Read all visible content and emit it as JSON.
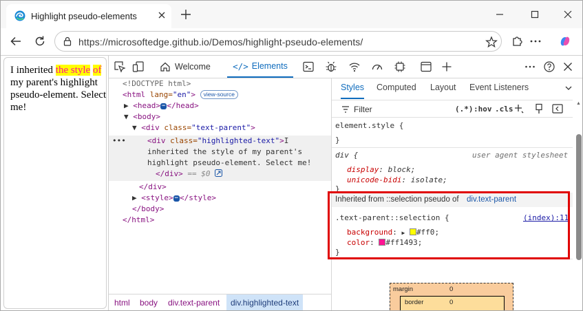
{
  "colors": {
    "accent": "#0f6cbd",
    "highlight_bg": "#ffff00",
    "highlight_fg": "#ff1493"
  },
  "browser": {
    "tab_title": "Highlight pseudo-elements",
    "url": "https://microsoftedge.github.io/Demos/highlight-pseudo-elements/"
  },
  "page": {
    "text_before": "I inherited ",
    "text_highlight_1": "the style",
    "text_highlight_2": "of",
    "text_after": " my parent's highlight pseudo-element. Select me!"
  },
  "devtools": {
    "tabs": {
      "welcome": "Welcome",
      "elements": "Elements"
    },
    "dom": {
      "doctype": "<!DOCTYPE html>",
      "html_open_tag": "<html",
      "html_lang_attr": " lang=",
      "html_lang_val": "\"en\"",
      "html_close_bracket": ">",
      "view_source": "view-source",
      "head_open": "<head>",
      "head_close": "</head>",
      "body_open": "<body>",
      "div_open": "<div",
      "class_attr": " class=",
      "text_parent_val": "\"text-parent\"",
      "close_bracket": ">",
      "highlighted_val": "\"highlighted-text\"",
      "text_line1": "I",
      "text_line2": "inherited the style of my parent's",
      "text_line3": "highlight pseudo-element. Select me!",
      "div_close": "</div>",
      "eq_dollar": " == $0",
      "style_open": "<style>",
      "style_close": "</style>",
      "body_close": "</body>",
      "html_close": "</html>",
      "row_ellipsis": "•••",
      "ellipsis": "⋯"
    },
    "breadcrumbs": [
      "html",
      "body",
      "div.text-parent",
      "div.highlighted-text"
    ],
    "styles": {
      "tabs": [
        "Styles",
        "Computed",
        "Layout",
        "Event Listeners"
      ],
      "filter": "Filter",
      "hov": ":hov",
      "cls": ".cls",
      "pseudo_toggle": "(.*)",
      "element_style": "element.style {",
      "close_brace": "}",
      "div_rule_selector": "div {",
      "user_agent": "user agent stylesheet",
      "display_prop": "display",
      "display_val": "block",
      "unicode_prop": "unicode-bidi",
      "unicode_val": "isolate",
      "inherited_from": "Inherited from ::selection pseudo of ",
      "inherited_link": "div.text-parent",
      "selection_selector": ".text-parent::selection {",
      "source_link": "(index):11",
      "background_prop": "background",
      "background_val": "#ff0",
      "color_prop": "color",
      "color_val": "#ff1493",
      "colon": ":",
      "semicolon": ";",
      "box_margin": "margin",
      "box_margin_val": "0",
      "box_border": "border",
      "box_border_val": "0"
    }
  }
}
